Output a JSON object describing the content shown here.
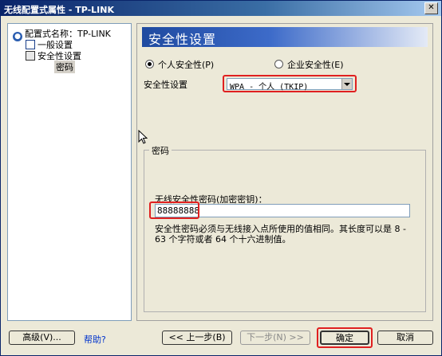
{
  "window": {
    "title": "无线配置式属性 - TP-LINK",
    "close_label": "✕"
  },
  "tree": {
    "root": "配置式名称：TP-LINK",
    "items": [
      "一般设置",
      "安全性设置",
      "密码"
    ]
  },
  "header": {
    "title": "安全性设置"
  },
  "security_type": {
    "personal_label": "个人安全性(P)",
    "enterprise_label": "企业安全性(E)",
    "selected": "personal"
  },
  "security_setting": {
    "label": "安全性设置",
    "value": "WPA - 个人 (TKIP)"
  },
  "password_group": {
    "title": "密码",
    "field_label": "无线安全性密码(加密密钥)：",
    "value": "88888888",
    "description": "安全性密码必须与无线接入点所使用的值相同。其长度可以是 8 - 63 个字符或者 64 个十六进制值。"
  },
  "buttons": {
    "advanced": "高级(V)...",
    "help": "帮助?",
    "back": "<< 上一步(B)",
    "next": "下一步(N) >>",
    "ok": "确定",
    "cancel": "取消"
  },
  "colors": {
    "header_blue": "#1f4aa0",
    "highlight_red": "#e02020",
    "title_bar": "#0a246a"
  }
}
